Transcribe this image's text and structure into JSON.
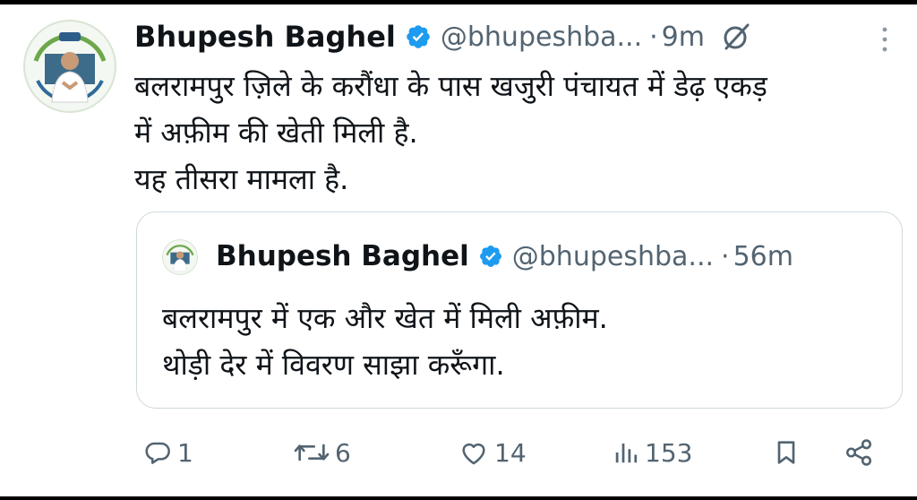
{
  "tweet": {
    "author_name": "Bhupesh Baghel",
    "handle": "@bhupeshba...",
    "separator": "·",
    "time": "9m",
    "body_lines": [
      "बलरामपुर ज़िले के करौंधा के पास खजुरी पंचायत में डेढ़ एकड़",
      "में अफ़ीम की खेती मिली है.",
      "यह तीसरा मामला है."
    ]
  },
  "quoted_tweet": {
    "author_name": "Bhupesh Baghel",
    "handle": "@bhupeshba...",
    "separator": "·",
    "time": "56m",
    "body_lines": [
      "बलरामपुर में एक और खेत में मिली अफ़ीम.",
      "थोड़ी देर में विवरण साझा करूँगा."
    ]
  },
  "actions": {
    "replies": "1",
    "reposts": "6",
    "likes": "14",
    "views": "153"
  },
  "icons": {
    "verified": "verified-badge-icon",
    "grok": "grok-icon",
    "more": "more-icon",
    "reply": "reply-icon",
    "repost": "repost-icon",
    "like": "like-icon",
    "views": "views-icon",
    "bookmark": "bookmark-icon",
    "share": "share-icon"
  },
  "colors": {
    "verified_blue": "#1d9bf0",
    "text_primary": "#0f1419",
    "text_secondary": "#536471",
    "quote_border": "#cfd9de"
  }
}
